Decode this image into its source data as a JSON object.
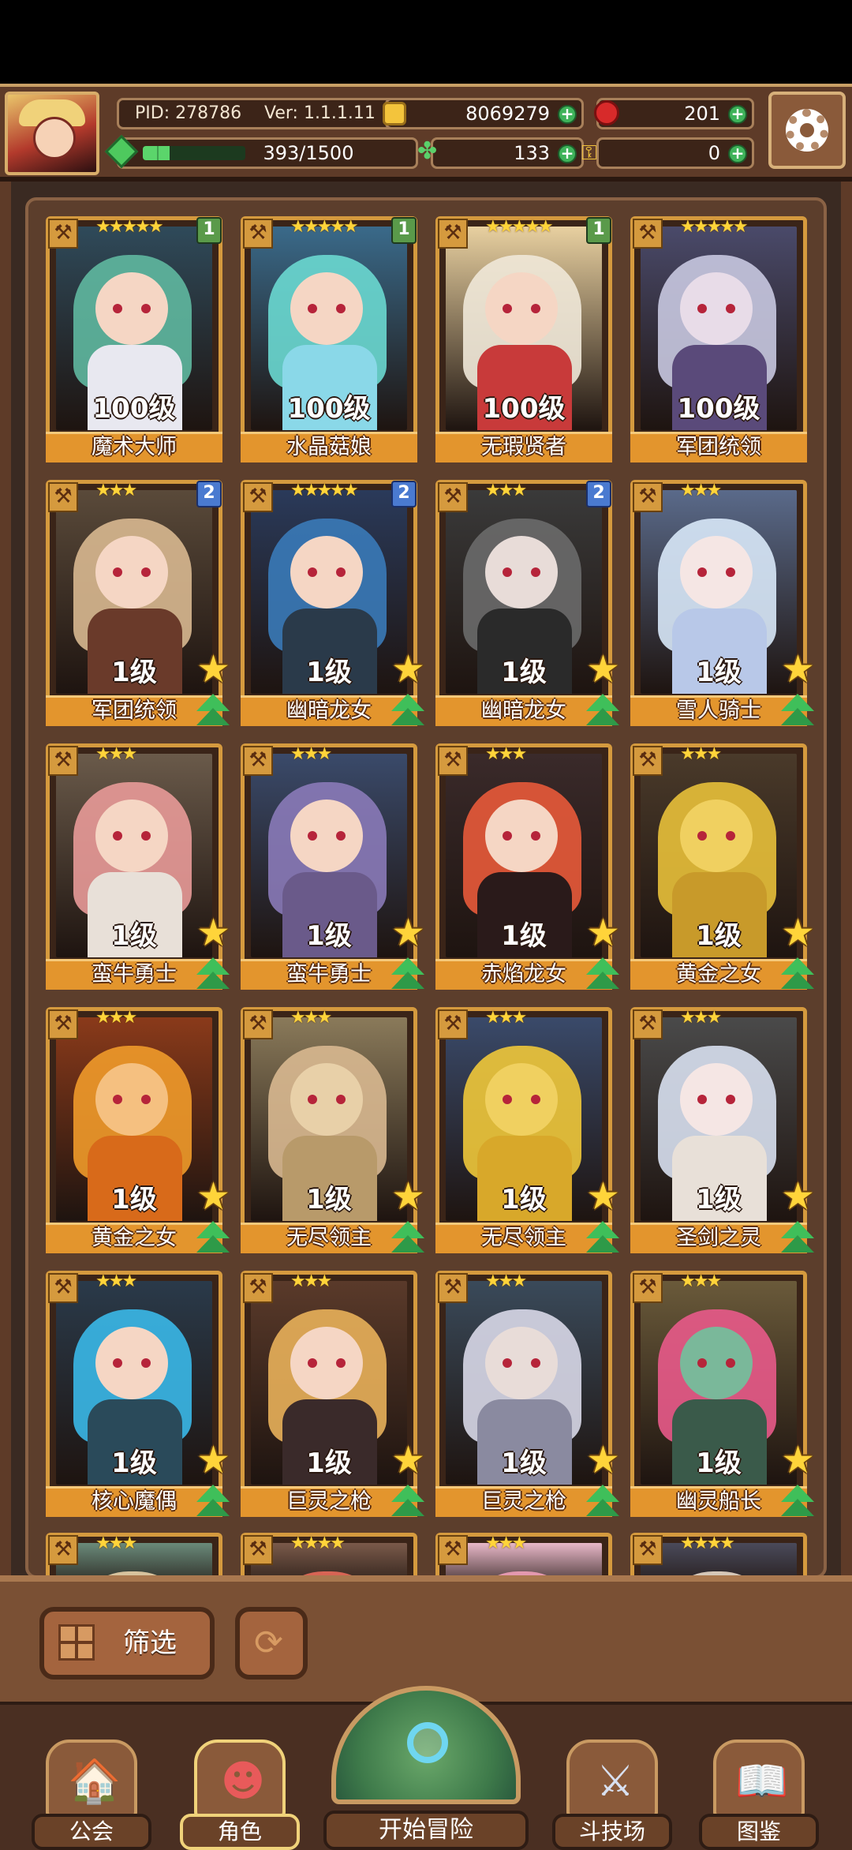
{
  "header": {
    "pid": "PID: 278786",
    "version": "Ver: 1.1.1.11",
    "gold": "8069279",
    "rubies": "201",
    "clovers": "133",
    "keys": "0",
    "xp_text": "393/1500",
    "xp_progress": 0.262
  },
  "cards": [
    {
      "name": "魔术大师",
      "level": "100级",
      "stars": "★★★★★",
      "badge": "1",
      "badge_color": "green",
      "palette": {
        "bg": "#2f4a5a",
        "hair": "#5fb8a0",
        "skin": "#f5d6c4",
        "body": "#e8e8f0"
      }
    },
    {
      "name": "水晶菇娘",
      "level": "100级",
      "stars": "★★★★★",
      "badge": "1",
      "badge_color": "green",
      "palette": {
        "bg": "#3a6a8a",
        "hair": "#6ad8d0",
        "skin": "#f5d6c4",
        "body": "#8ad8e8"
      }
    },
    {
      "name": "无瑕贤者",
      "level": "100级",
      "stars": "★★★★★",
      "badge": "1",
      "badge_color": "green",
      "palette": {
        "bg": "#e8d0a0",
        "hair": "#f0e8d8",
        "skin": "#f5d6c4",
        "body": "#c83a3a"
      }
    },
    {
      "name": "军团统领",
      "level": "100级",
      "stars": "★★★★★",
      "badge": "",
      "badge_color": "",
      "palette": {
        "bg": "#4a4a6a",
        "hair": "#c8c8e0",
        "skin": "#e8dce8",
        "body": "#5a4a7a"
      }
    },
    {
      "name": "军团统领",
      "level": "1级",
      "stars": "★★★",
      "badge": "2",
      "badge_color": "blue",
      "palette": {
        "bg": "#5a4a3a",
        "hair": "#d8b890",
        "skin": "#f5d6c4",
        "body": "#6a3a2a"
      }
    },
    {
      "name": "幽暗龙女",
      "level": "1级",
      "stars": "★★★★★",
      "badge": "2",
      "badge_color": "blue",
      "palette": {
        "bg": "#2a3a5a",
        "hair": "#3a7ab8",
        "skin": "#f5d6c4",
        "body": "#2a3a4a"
      }
    },
    {
      "name": "幽暗龙女",
      "level": "1级",
      "stars": "★★★",
      "badge": "2",
      "badge_color": "blue",
      "palette": {
        "bg": "#3a3a3a",
        "hair": "#6a6a6a",
        "skin": "#e8dcd8",
        "body": "#2a2a2a"
      }
    },
    {
      "name": "雪人骑士",
      "level": "1级",
      "stars": "★★★",
      "badge": "",
      "badge_color": "",
      "palette": {
        "bg": "#5a6a8a",
        "hair": "#d8e8f8",
        "skin": "#f5e6e4",
        "body": "#b8c8e8"
      }
    },
    {
      "name": "蛮牛勇士",
      "level": "1级",
      "stars": "★★★",
      "badge": "",
      "badge_color": "",
      "palette": {
        "bg": "#6a5a4a",
        "hair": "#e89a98",
        "skin": "#f5d6c4",
        "body": "#e8e0d8"
      }
    },
    {
      "name": "蛮牛勇士",
      "level": "1级",
      "stars": "★★★",
      "badge": "",
      "badge_color": "",
      "palette": {
        "bg": "#3a4a6a",
        "hair": "#8a7ab8",
        "skin": "#f5d6c4",
        "body": "#6a5a8a"
      }
    },
    {
      "name": "赤焰龙女",
      "level": "1级",
      "stars": "★★★",
      "badge": "",
      "badge_color": "",
      "palette": {
        "bg": "#3a2a2a",
        "hair": "#e85a3a",
        "skin": "#f5d6c4",
        "body": "#2a1a1a"
      }
    },
    {
      "name": "黄金之女",
      "level": "1级",
      "stars": "★★★",
      "badge": "",
      "badge_color": "",
      "palette": {
        "bg": "#4a3a2a",
        "hair": "#e8c03a",
        "skin": "#f0d060",
        "body": "#c89a2a"
      }
    },
    {
      "name": "黄金之女",
      "level": "1级",
      "stars": "★★★",
      "badge": "",
      "badge_color": "",
      "palette": {
        "bg": "#8a3a1a",
        "hair": "#f09a2a",
        "skin": "#f5c080",
        "body": "#d86a1a"
      }
    },
    {
      "name": "无尽领主",
      "level": "1级",
      "stars": "★★★",
      "badge": "",
      "badge_color": "",
      "palette": {
        "bg": "#8a7a5a",
        "hair": "#d8b890",
        "skin": "#e8d0a8",
        "body": "#b89a6a"
      }
    },
    {
      "name": "无尽领主",
      "level": "1级",
      "stars": "★★★",
      "badge": "",
      "badge_color": "",
      "palette": {
        "bg": "#3a4a6a",
        "hair": "#f0c83a",
        "skin": "#f0d060",
        "body": "#d8a82a"
      }
    },
    {
      "name": "圣剑之灵",
      "level": "1级",
      "stars": "★★★",
      "badge": "",
      "badge_color": "",
      "palette": {
        "bg": "#4a4a4a",
        "hair": "#d8e0f0",
        "skin": "#f5e6e4",
        "body": "#e8e0d8"
      }
    },
    {
      "name": "核心魔偶",
      "level": "1级",
      "stars": "★★★",
      "badge": "",
      "badge_color": "",
      "palette": {
        "bg": "#2a3a4a",
        "hair": "#3ab8e8",
        "skin": "#f5d6c4",
        "body": "#2a4a5a"
      }
    },
    {
      "name": "巨灵之枪",
      "level": "1级",
      "stars": "★★★",
      "badge": "",
      "badge_color": "",
      "palette": {
        "bg": "#5a3a2a",
        "hair": "#e8b05a",
        "skin": "#f5d6c4",
        "body": "#3a2a2a"
      }
    },
    {
      "name": "巨灵之枪",
      "level": "1级",
      "stars": "★★★",
      "badge": "",
      "badge_color": "",
      "palette": {
        "bg": "#3a4a5a",
        "hair": "#d8d8e8",
        "skin": "#e8dcd8",
        "body": "#8a8aa0"
      }
    },
    {
      "name": "幽灵船长",
      "level": "1级",
      "stars": "★★★",
      "badge": "",
      "badge_color": "",
      "palette": {
        "bg": "#6a5a3a",
        "hair": "#e85a8a",
        "skin": "#7ab89a",
        "body": "#3a5a4a"
      }
    }
  ],
  "partial_row": [
    {
      "stars": "★★★",
      "palette": {
        "bg": "#6a8a7a",
        "hair": "#e8d0a8"
      }
    },
    {
      "stars": "★★★★",
      "palette": {
        "bg": "#7a5a4a",
        "hair": "#e86a5a"
      }
    },
    {
      "stars": "★★★",
      "palette": {
        "bg": "#e8b8c8",
        "hair": "#f0a0b8"
      }
    },
    {
      "stars": "★★★★",
      "palette": {
        "bg": "#4a4a5a",
        "hair": "#e8d8c8"
      }
    }
  ],
  "filter": {
    "label": "筛选",
    "grid_icon": "grid-icon",
    "refresh_icon": "refresh-icon"
  },
  "nav": {
    "guild": "公会",
    "characters": "角色",
    "adventure": "开始冒险",
    "arena": "斗技场",
    "codex": "图鉴"
  }
}
